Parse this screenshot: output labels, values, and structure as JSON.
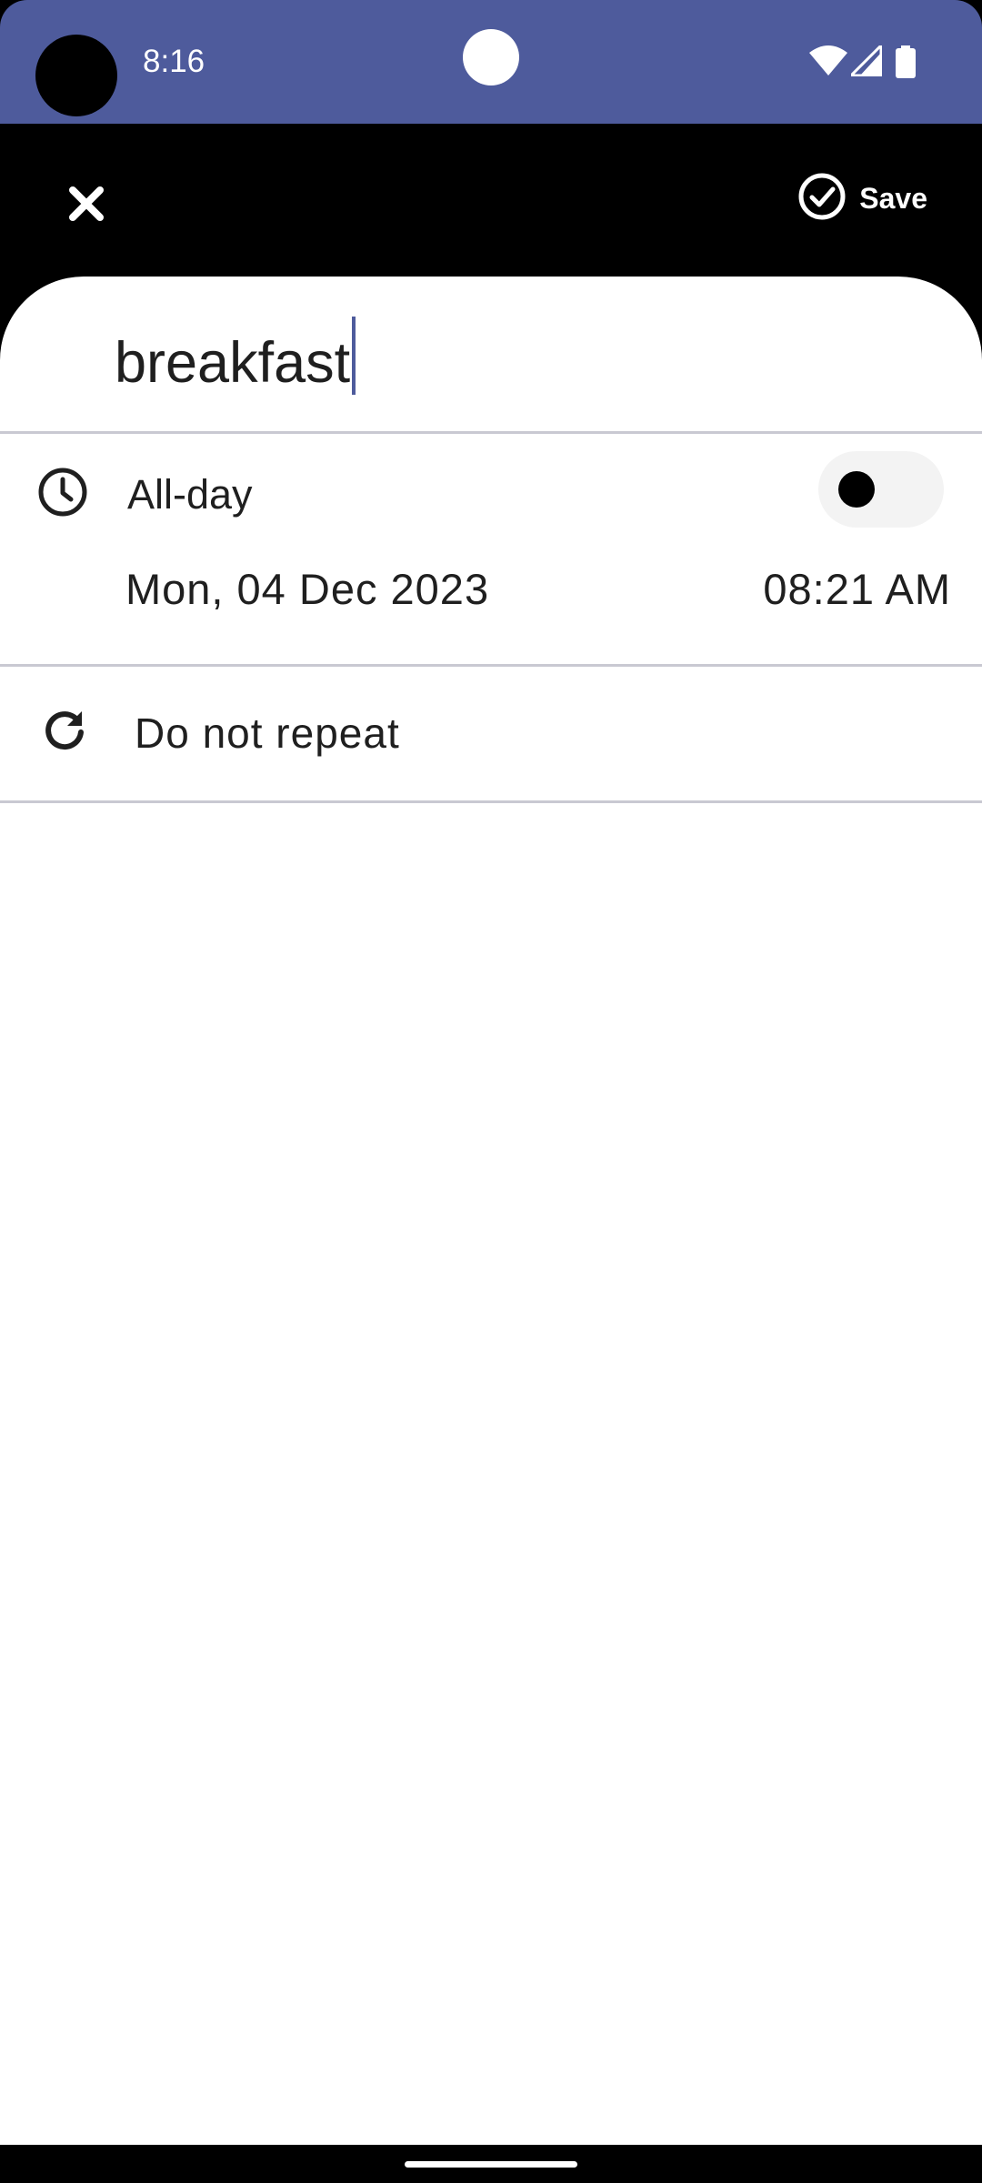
{
  "status_bar": {
    "time": "8:16",
    "background_color": "#4e5b9c",
    "icons": [
      "wifi-icon",
      "signal-icon",
      "battery-icon"
    ]
  },
  "toolbar": {
    "close_icon": "close-icon",
    "save_icon": "check-circle-icon",
    "save_label": "Save"
  },
  "event": {
    "title": "breakfast",
    "all_day_label": "All-day",
    "all_day_enabled": false,
    "date": "Mon, 04 Dec 2023",
    "time": "08:21 AM",
    "repeat_label": "Do not repeat"
  },
  "colors": {
    "accent": "#4e5b9c",
    "divider": "#c9c9d2",
    "text": "#1f1f1f"
  }
}
